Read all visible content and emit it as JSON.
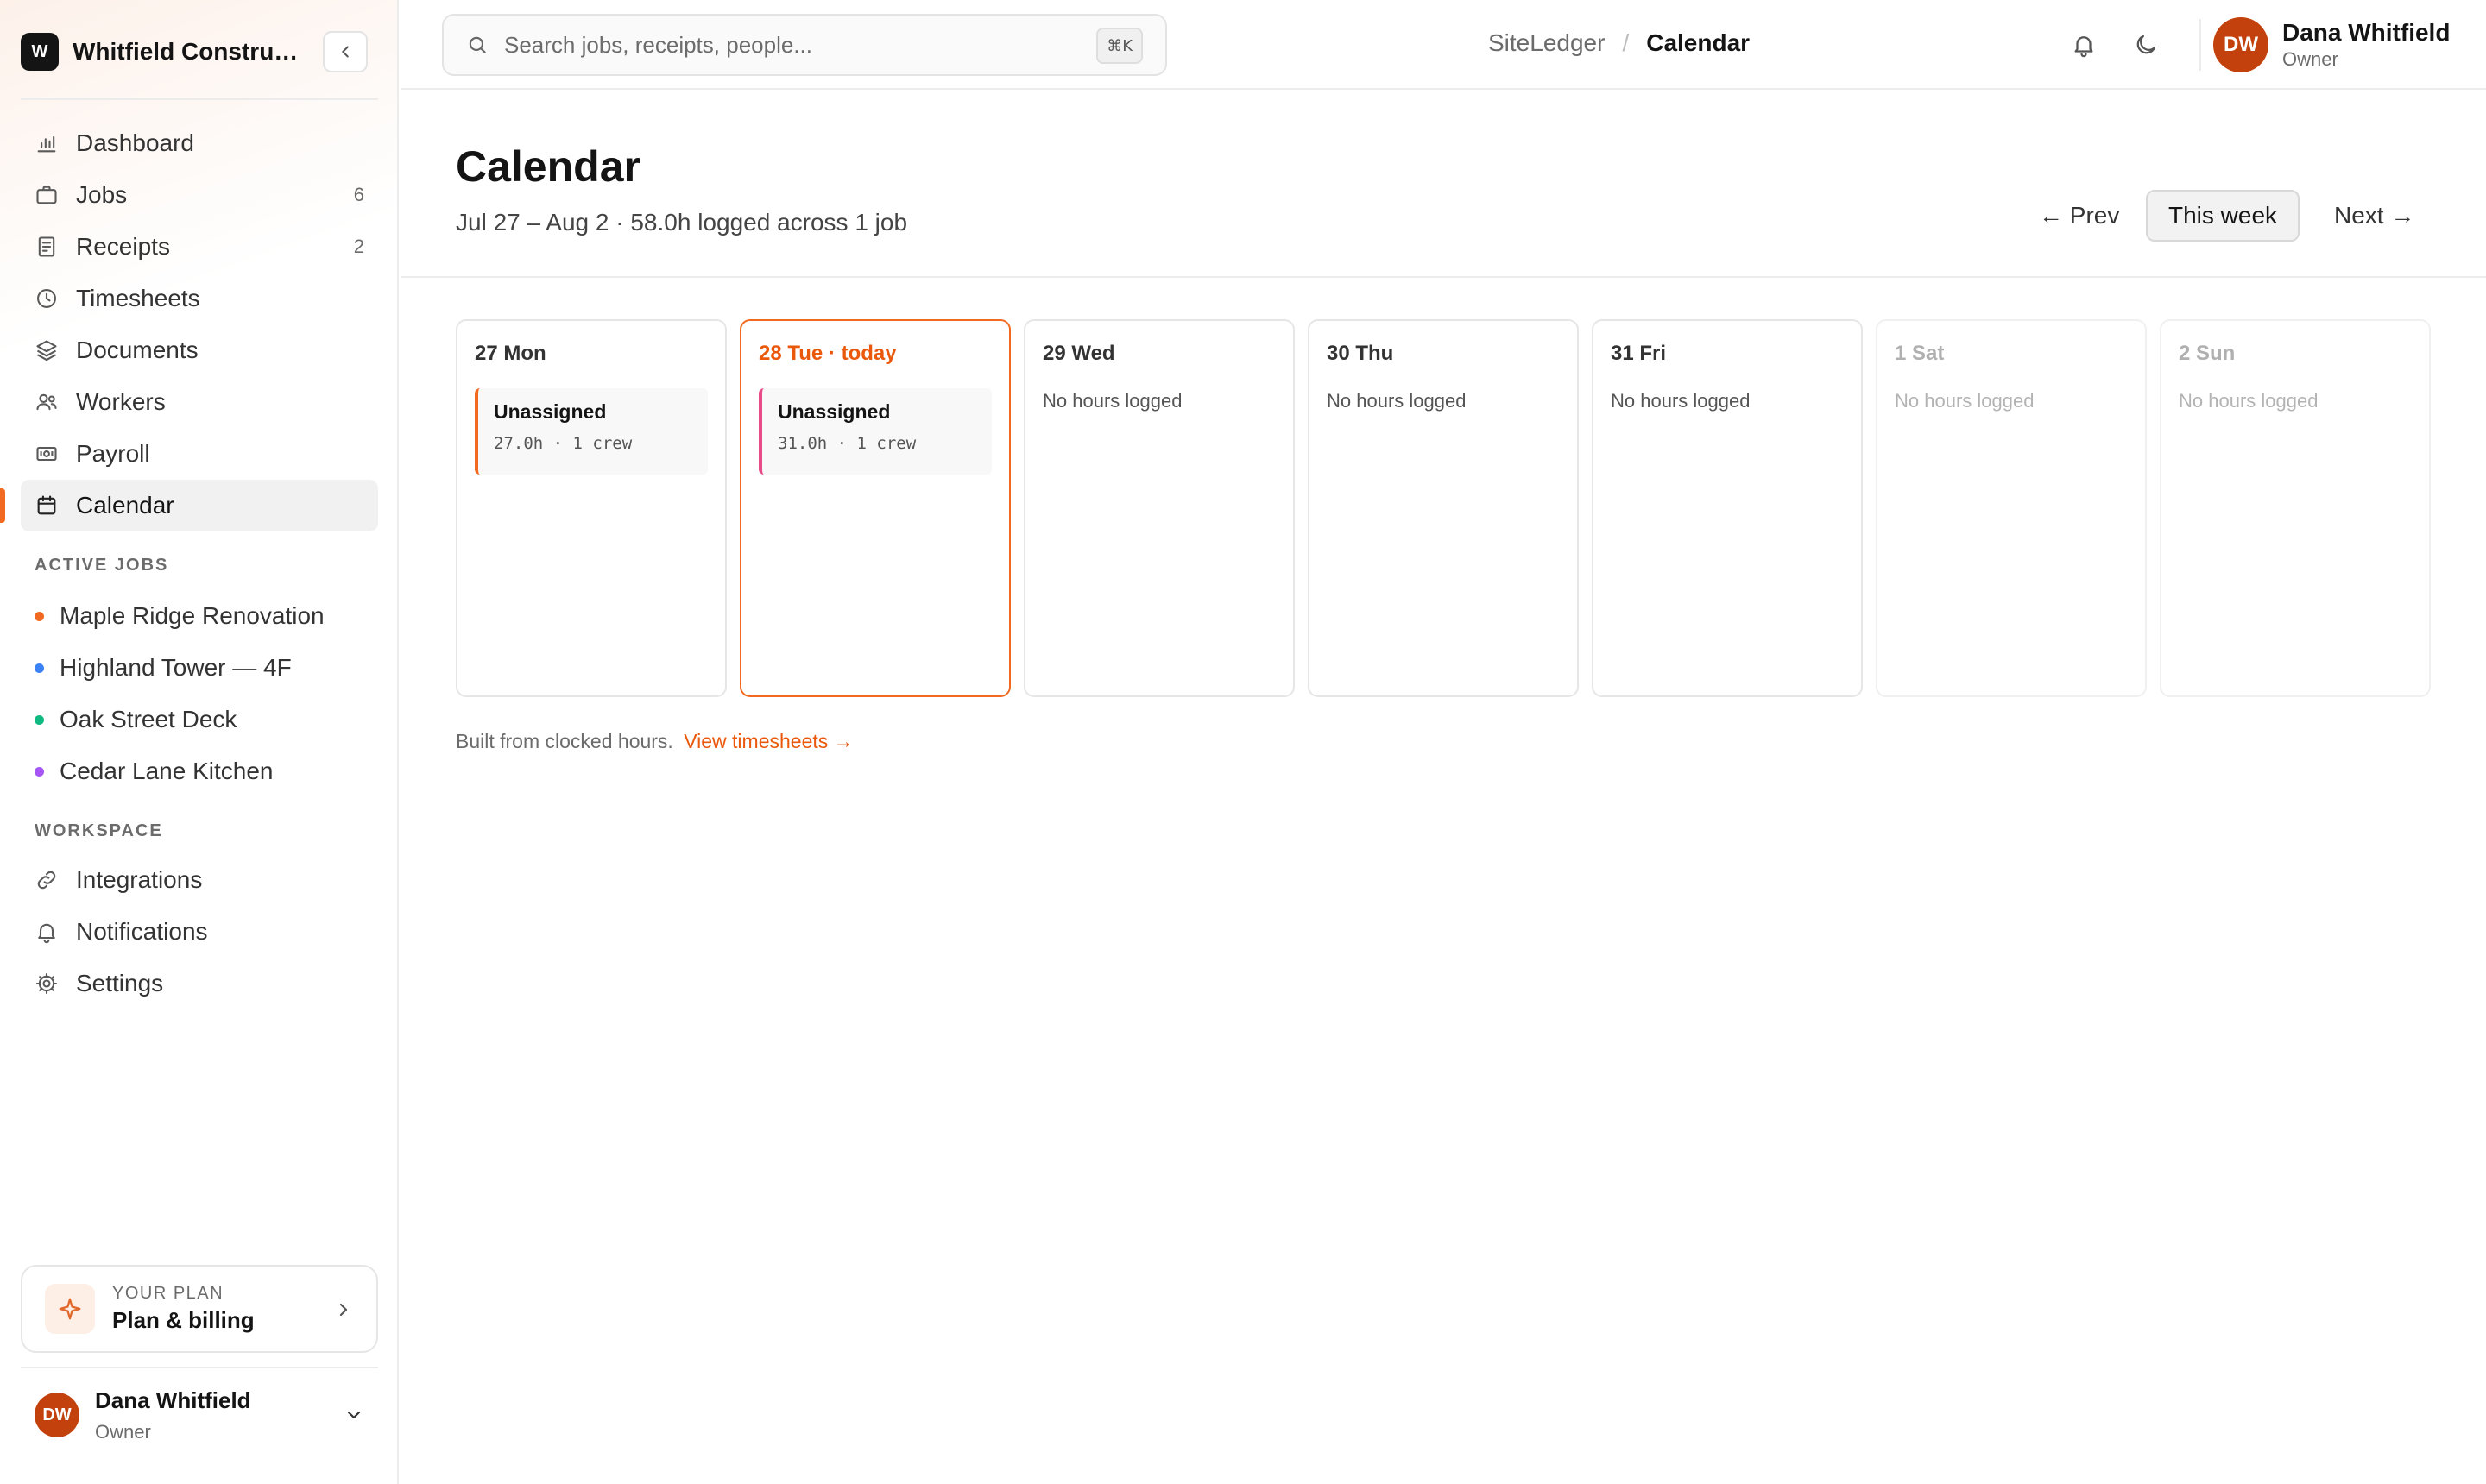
{
  "workspace": {
    "logo_letter": "W",
    "name": "Whitfield Construc..."
  },
  "sidebar": {
    "nav": [
      {
        "label": "Dashboard",
        "icon": "bar-chart-icon",
        "count": ""
      },
      {
        "label": "Jobs",
        "icon": "briefcase-icon",
        "count": "6"
      },
      {
        "label": "Receipts",
        "icon": "receipt-icon",
        "count": "2"
      },
      {
        "label": "Timesheets",
        "icon": "clock-icon",
        "count": ""
      },
      {
        "label": "Documents",
        "icon": "layers-icon",
        "count": ""
      },
      {
        "label": "Workers",
        "icon": "users-icon",
        "count": ""
      },
      {
        "label": "Payroll",
        "icon": "cash-icon",
        "count": ""
      },
      {
        "label": "Calendar",
        "icon": "calendar-icon",
        "count": "",
        "active": true
      }
    ],
    "active_jobs_label": "ACTIVE JOBS",
    "active_jobs": [
      {
        "label": "Maple Ridge Renovation",
        "color": "#f26a21"
      },
      {
        "label": "Highland Tower — 4F",
        "color": "#3b82f6"
      },
      {
        "label": "Oak Street Deck",
        "color": "#10b981"
      },
      {
        "label": "Cedar Lane Kitchen",
        "color": "#a855f7"
      }
    ],
    "workspace_label": "WORKSPACE",
    "workspace_nav": [
      {
        "label": "Integrations",
        "icon": "link-icon"
      },
      {
        "label": "Notifications",
        "icon": "bell-icon"
      },
      {
        "label": "Settings",
        "icon": "gear-icon"
      }
    ],
    "plan": {
      "small": "YOUR PLAN",
      "title": "Plan & billing"
    },
    "user": {
      "initials": "DW",
      "name": "Dana Whitfield",
      "role": "Owner"
    }
  },
  "topbar": {
    "search_placeholder": "Search jobs, receipts, people...",
    "shortcut": "⌘K",
    "breadcrumb_root": "SiteLedger",
    "breadcrumb_sep": "/",
    "breadcrumb_current": "Calendar",
    "user": {
      "initials": "DW",
      "name": "Dana Whitfield",
      "role": "Owner"
    }
  },
  "page": {
    "title": "Calendar",
    "subtitle": "Jul 27 – Aug 2 · 58.0h logged across 1 job",
    "prev_label": "← Prev",
    "this_week_label": "This week",
    "next_label": "Next →"
  },
  "days": [
    {
      "label": "27 Mon",
      "state": "normal",
      "entry": {
        "title": "Unassigned",
        "meta": "27.0h · 1 crew",
        "color": "#f26a21"
      }
    },
    {
      "label": "28 Tue · today",
      "state": "today",
      "entry": {
        "title": "Unassigned",
        "meta": "31.0h · 1 crew",
        "color": "#e84a8a"
      }
    },
    {
      "label": "29 Wed",
      "state": "normal",
      "empty_text": "No hours logged"
    },
    {
      "label": "30 Thu",
      "state": "normal",
      "empty_text": "No hours logged"
    },
    {
      "label": "31 Fri",
      "state": "normal",
      "empty_text": "No hours logged"
    },
    {
      "label": "1 Sat",
      "state": "weekend",
      "empty_text": "No hours logged"
    },
    {
      "label": "2 Sun",
      "state": "weekend",
      "empty_text": "No hours logged"
    }
  ],
  "footnote": {
    "text": "Built from clocked hours.",
    "link": "View timesheets →"
  }
}
